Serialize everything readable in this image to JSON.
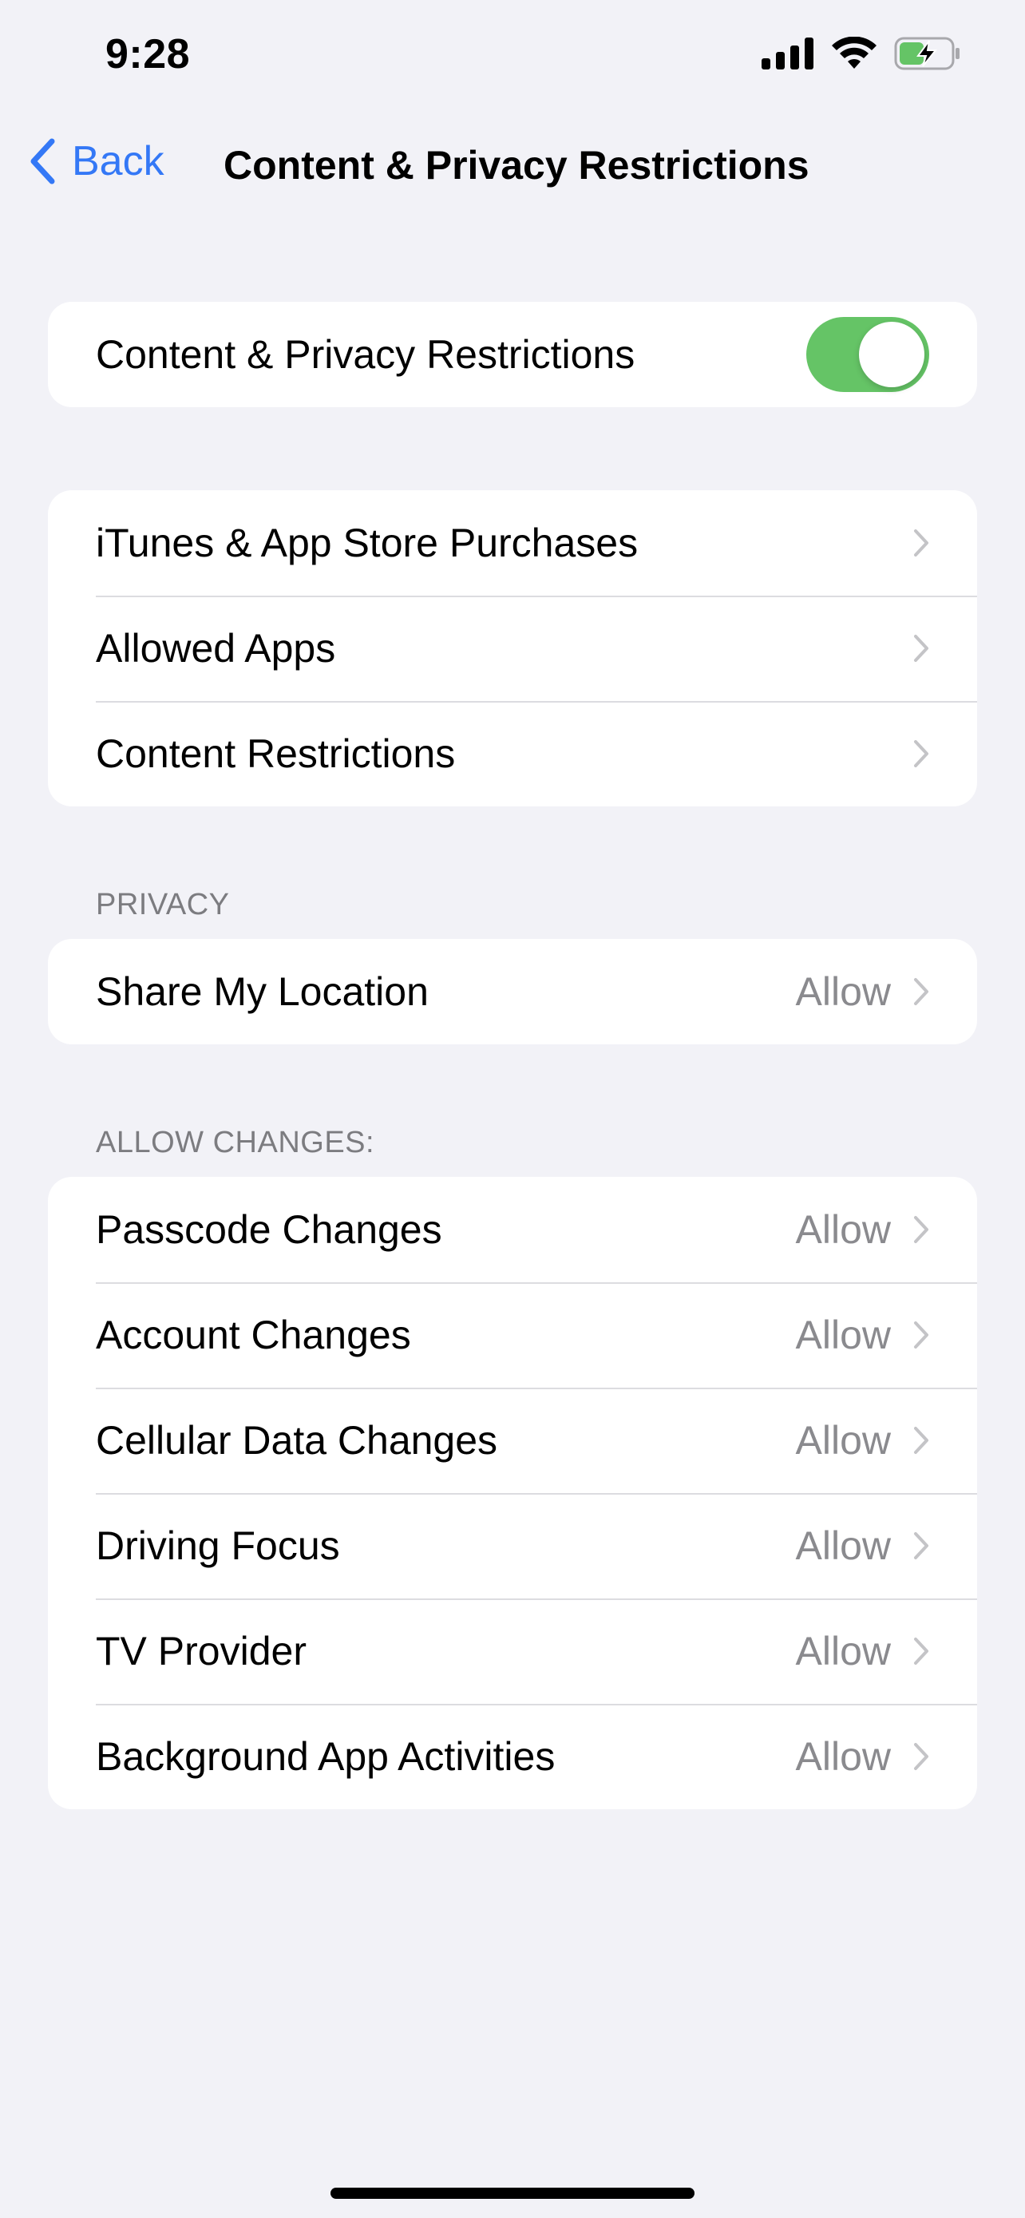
{
  "status_bar": {
    "time": "9:28",
    "icons": [
      "cellular-signal-icon",
      "wifi-icon",
      "battery-charging-icon"
    ]
  },
  "nav": {
    "back_label": "Back",
    "title": "Content & Privacy Restrictions"
  },
  "main_toggle": {
    "label": "Content & Privacy Restrictions",
    "on": true
  },
  "store_group": {
    "items": [
      {
        "label": "iTunes & App Store Purchases"
      },
      {
        "label": "Allowed Apps"
      },
      {
        "label": "Content Restrictions"
      }
    ]
  },
  "privacy": {
    "header": "PRIVACY",
    "items": [
      {
        "label": "Share My Location",
        "value": "Allow"
      }
    ]
  },
  "allow_changes": {
    "header": "ALLOW CHANGES:",
    "items": [
      {
        "label": "Passcode Changes",
        "value": "Allow"
      },
      {
        "label": "Account Changes",
        "value": "Allow"
      },
      {
        "label": "Cellular Data Changes",
        "value": "Allow"
      },
      {
        "label": "Driving Focus",
        "value": "Allow"
      },
      {
        "label": "TV Provider",
        "value": "Allow"
      },
      {
        "label": "Background App Activities",
        "value": "Allow"
      }
    ]
  },
  "colors": {
    "accent": "#3478f6",
    "toggle_on": "#65c466",
    "background": "#f2f2f7",
    "secondary_text": "#8a8a8e"
  }
}
